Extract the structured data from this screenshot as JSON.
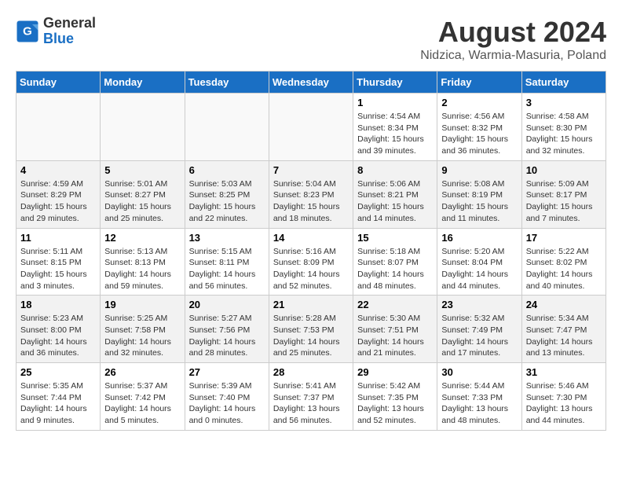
{
  "header": {
    "logo_line1": "General",
    "logo_line2": "Blue",
    "month_year": "August 2024",
    "location": "Nidzica, Warmia-Masuria, Poland"
  },
  "days_of_week": [
    "Sunday",
    "Monday",
    "Tuesday",
    "Wednesday",
    "Thursday",
    "Friday",
    "Saturday"
  ],
  "weeks": [
    [
      {
        "day": "",
        "info": ""
      },
      {
        "day": "",
        "info": ""
      },
      {
        "day": "",
        "info": ""
      },
      {
        "day": "",
        "info": ""
      },
      {
        "day": "1",
        "info": "Sunrise: 4:54 AM\nSunset: 8:34 PM\nDaylight: 15 hours\nand 39 minutes."
      },
      {
        "day": "2",
        "info": "Sunrise: 4:56 AM\nSunset: 8:32 PM\nDaylight: 15 hours\nand 36 minutes."
      },
      {
        "day": "3",
        "info": "Sunrise: 4:58 AM\nSunset: 8:30 PM\nDaylight: 15 hours\nand 32 minutes."
      }
    ],
    [
      {
        "day": "4",
        "info": "Sunrise: 4:59 AM\nSunset: 8:29 PM\nDaylight: 15 hours\nand 29 minutes."
      },
      {
        "day": "5",
        "info": "Sunrise: 5:01 AM\nSunset: 8:27 PM\nDaylight: 15 hours\nand 25 minutes."
      },
      {
        "day": "6",
        "info": "Sunrise: 5:03 AM\nSunset: 8:25 PM\nDaylight: 15 hours\nand 22 minutes."
      },
      {
        "day": "7",
        "info": "Sunrise: 5:04 AM\nSunset: 8:23 PM\nDaylight: 15 hours\nand 18 minutes."
      },
      {
        "day": "8",
        "info": "Sunrise: 5:06 AM\nSunset: 8:21 PM\nDaylight: 15 hours\nand 14 minutes."
      },
      {
        "day": "9",
        "info": "Sunrise: 5:08 AM\nSunset: 8:19 PM\nDaylight: 15 hours\nand 11 minutes."
      },
      {
        "day": "10",
        "info": "Sunrise: 5:09 AM\nSunset: 8:17 PM\nDaylight: 15 hours\nand 7 minutes."
      }
    ],
    [
      {
        "day": "11",
        "info": "Sunrise: 5:11 AM\nSunset: 8:15 PM\nDaylight: 15 hours\nand 3 minutes."
      },
      {
        "day": "12",
        "info": "Sunrise: 5:13 AM\nSunset: 8:13 PM\nDaylight: 14 hours\nand 59 minutes."
      },
      {
        "day": "13",
        "info": "Sunrise: 5:15 AM\nSunset: 8:11 PM\nDaylight: 14 hours\nand 56 minutes."
      },
      {
        "day": "14",
        "info": "Sunrise: 5:16 AM\nSunset: 8:09 PM\nDaylight: 14 hours\nand 52 minutes."
      },
      {
        "day": "15",
        "info": "Sunrise: 5:18 AM\nSunset: 8:07 PM\nDaylight: 14 hours\nand 48 minutes."
      },
      {
        "day": "16",
        "info": "Sunrise: 5:20 AM\nSunset: 8:04 PM\nDaylight: 14 hours\nand 44 minutes."
      },
      {
        "day": "17",
        "info": "Sunrise: 5:22 AM\nSunset: 8:02 PM\nDaylight: 14 hours\nand 40 minutes."
      }
    ],
    [
      {
        "day": "18",
        "info": "Sunrise: 5:23 AM\nSunset: 8:00 PM\nDaylight: 14 hours\nand 36 minutes."
      },
      {
        "day": "19",
        "info": "Sunrise: 5:25 AM\nSunset: 7:58 PM\nDaylight: 14 hours\nand 32 minutes."
      },
      {
        "day": "20",
        "info": "Sunrise: 5:27 AM\nSunset: 7:56 PM\nDaylight: 14 hours\nand 28 minutes."
      },
      {
        "day": "21",
        "info": "Sunrise: 5:28 AM\nSunset: 7:53 PM\nDaylight: 14 hours\nand 25 minutes."
      },
      {
        "day": "22",
        "info": "Sunrise: 5:30 AM\nSunset: 7:51 PM\nDaylight: 14 hours\nand 21 minutes."
      },
      {
        "day": "23",
        "info": "Sunrise: 5:32 AM\nSunset: 7:49 PM\nDaylight: 14 hours\nand 17 minutes."
      },
      {
        "day": "24",
        "info": "Sunrise: 5:34 AM\nSunset: 7:47 PM\nDaylight: 14 hours\nand 13 minutes."
      }
    ],
    [
      {
        "day": "25",
        "info": "Sunrise: 5:35 AM\nSunset: 7:44 PM\nDaylight: 14 hours\nand 9 minutes."
      },
      {
        "day": "26",
        "info": "Sunrise: 5:37 AM\nSunset: 7:42 PM\nDaylight: 14 hours\nand 5 minutes."
      },
      {
        "day": "27",
        "info": "Sunrise: 5:39 AM\nSunset: 7:40 PM\nDaylight: 14 hours\nand 0 minutes."
      },
      {
        "day": "28",
        "info": "Sunrise: 5:41 AM\nSunset: 7:37 PM\nDaylight: 13 hours\nand 56 minutes."
      },
      {
        "day": "29",
        "info": "Sunrise: 5:42 AM\nSunset: 7:35 PM\nDaylight: 13 hours\nand 52 minutes."
      },
      {
        "day": "30",
        "info": "Sunrise: 5:44 AM\nSunset: 7:33 PM\nDaylight: 13 hours\nand 48 minutes."
      },
      {
        "day": "31",
        "info": "Sunrise: 5:46 AM\nSunset: 7:30 PM\nDaylight: 13 hours\nand 44 minutes."
      }
    ]
  ]
}
